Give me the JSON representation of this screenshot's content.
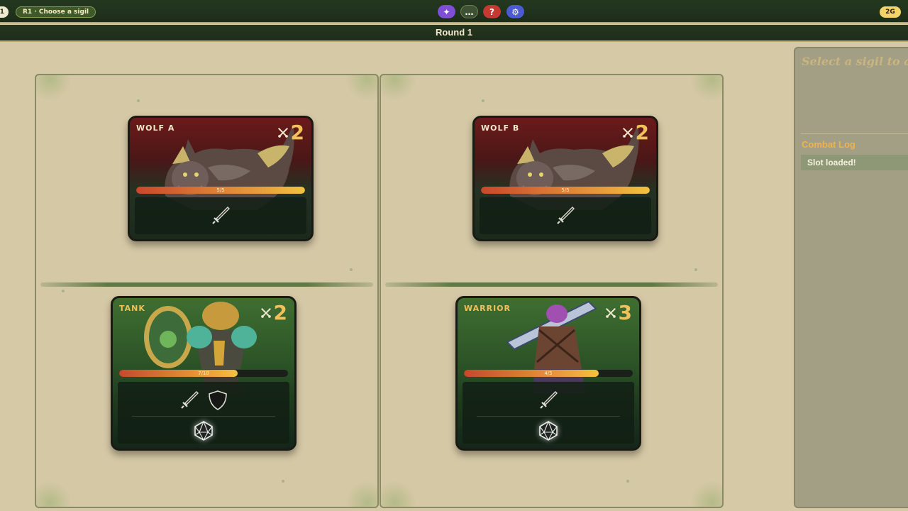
{
  "topbar": {
    "left_pill": "1",
    "phase": "R1 · Choose a sigil",
    "buttons": [
      {
        "icon": "sparkle-icon",
        "glyph": "✦"
      },
      {
        "icon": "more-icon",
        "glyph": "…"
      },
      {
        "icon": "help-icon",
        "glyph": "?"
      },
      {
        "icon": "settings-icon",
        "glyph": "⚙"
      }
    ],
    "gold": "2G"
  },
  "round": {
    "title": "Round 1"
  },
  "cards": {
    "wolf_a": {
      "name": "WOLF A",
      "attack": "2",
      "hp": "5/5",
      "hp_fraction": 1.0,
      "side": "enemy"
    },
    "wolf_b": {
      "name": "WOLF B",
      "attack": "2",
      "hp": "5/5",
      "hp_fraction": 1.0,
      "side": "enemy"
    },
    "tank": {
      "name": "TANK",
      "attack": "2",
      "hp": "7/10",
      "hp_fraction": 0.7,
      "side": "ally"
    },
    "warrior": {
      "name": "WARRIOR",
      "attack": "3",
      "hp": "4/5",
      "hp_fraction": 0.8,
      "side": "ally"
    }
  },
  "side_panel": {
    "hint": "Select a sigil to ac",
    "log_title": "Combat Log",
    "log_entries": [
      "Slot loaded!"
    ]
  },
  "colors": {
    "accent_gold": "#f0c15a",
    "enemy_card": "#6b1a1a",
    "ally_card": "#3f6e31",
    "hp_bar": "#e69a3a"
  }
}
